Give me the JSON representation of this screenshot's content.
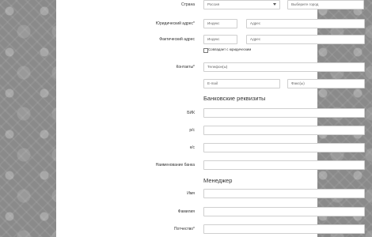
{
  "form": {
    "country": {
      "label": "Страна",
      "value": "Россия",
      "city_placeholder": "Выберите город"
    },
    "legal_address": {
      "label": "Юридический адрес*",
      "index_placeholder": "Индекс",
      "address_placeholder": "Адрес"
    },
    "actual_address": {
      "label": "Фактический адрес",
      "index_placeholder": "Индекс",
      "address_placeholder": "Адрес"
    },
    "same_as_legal": {
      "label": "Совпадает с юридическим"
    },
    "contacts": {
      "label": "Контакты*",
      "phone_placeholder": "Телефон(ы)",
      "email_placeholder": "E-mail",
      "fax_placeholder": "Факс(ы)"
    }
  },
  "bank": {
    "heading": "Банковские реквизиты",
    "bik_label": "БИК",
    "rs_label": "р/с",
    "ks_label": "к/с",
    "bank_name_label": "Наименование банка"
  },
  "manager": {
    "heading": "Менеджер",
    "first_name_label": "Имя",
    "last_name_label": "Фамилия",
    "patronymic_label": "Потчество*"
  }
}
